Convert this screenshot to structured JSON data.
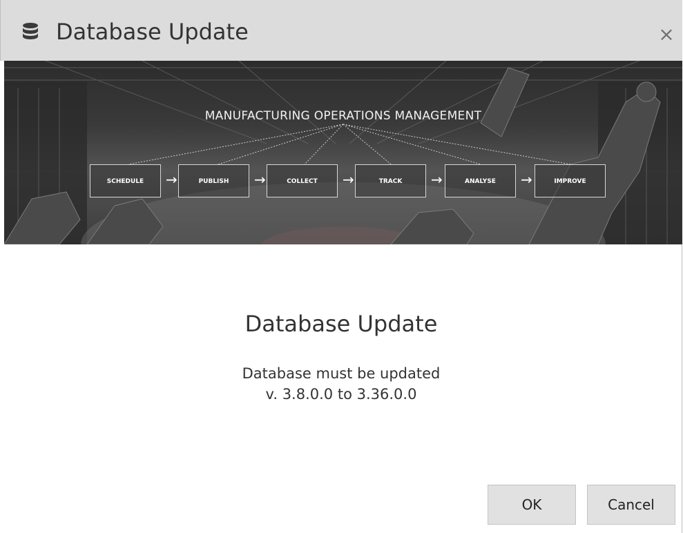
{
  "titlebar": {
    "icon": "database-icon",
    "title": "Database Update",
    "close_label": "×",
    "close_icon": "close-icon"
  },
  "banner": {
    "heading": "MANUFACTURING OPERATIONS MANAGEMENT",
    "steps": [
      "SCHEDULE",
      "PUBLISH",
      "COLLECT",
      "TRACK",
      "ANALYSE",
      "IMPROVE"
    ],
    "arrow_glyph": "→"
  },
  "content": {
    "heading": "Database Update",
    "line1": "Database must be updated",
    "line2": "v. 3.8.0.0 to 3.36.0.0"
  },
  "buttons": {
    "ok_label": "OK",
    "cancel_label": "Cancel"
  },
  "colors": {
    "titlebar_bg": "#dcdcdc",
    "button_bg": "#e1e1e1",
    "text": "#333333"
  }
}
